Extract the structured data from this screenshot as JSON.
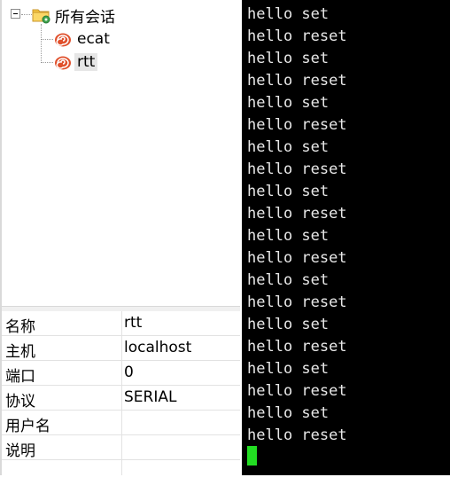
{
  "session_tree": {
    "root_label": "所有会话",
    "items": [
      {
        "label": "ecat"
      },
      {
        "label": "rtt",
        "selected": true
      }
    ]
  },
  "properties": [
    {
      "key": "名称",
      "value": "rtt"
    },
    {
      "key": "主机",
      "value": "localhost"
    },
    {
      "key": "端口",
      "value": "0"
    },
    {
      "key": "协议",
      "value": "SERIAL"
    },
    {
      "key": "用户名",
      "value": ""
    },
    {
      "key": "说明",
      "value": ""
    },
    {
      "key": "",
      "value": ""
    }
  ],
  "terminal": {
    "lines": [
      "hello set",
      "hello reset",
      "hello set",
      "hello reset",
      "hello set",
      "hello reset",
      "hello set",
      "hello reset",
      "hello set",
      "hello reset",
      "hello set",
      "hello reset",
      "hello set",
      "hello reset",
      "hello set",
      "hello reset",
      "hello set",
      "hello reset",
      "hello set",
      "hello reset"
    ],
    "cursor_color": "#22dd22",
    "background": "#000000"
  },
  "icons": {
    "root": "folder-gear-icon",
    "session": "spiral-shell-icon"
  }
}
